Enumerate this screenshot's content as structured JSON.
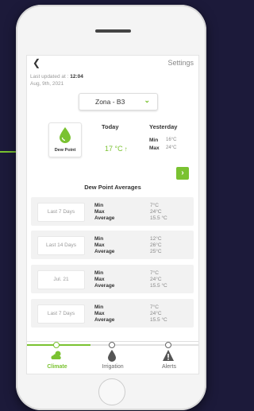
{
  "colors": {
    "accent": "#7ac231",
    "background": "#1c1a3a"
  },
  "header": {
    "back_icon": "back-arrow-icon",
    "settings_label": "Settings"
  },
  "updated": {
    "prefix": "Last updated at : ",
    "time": "12:04",
    "date": "Aug, 9th, 2021"
  },
  "zone": {
    "label": "Zona - B3",
    "icon": "chevron-down-icon"
  },
  "dew_point": {
    "label": "Dew Point",
    "icon": "droplet-icon"
  },
  "today": {
    "heading": "Today",
    "value": "17 °C",
    "trend_icon": "arrow-up-icon"
  },
  "yesterday": {
    "heading": "Yesterday",
    "min_label": "Min",
    "min_value": "16°C",
    "max_label": "Max",
    "max_value": "24°C"
  },
  "next_icon": "chevron-right-icon",
  "averages": {
    "title": "Dew Point Averages",
    "labels": {
      "min": "Min",
      "max": "Max",
      "avg": "Average"
    },
    "rows": [
      {
        "period": "Last 7 Days",
        "min": "7°C",
        "max": "24°C",
        "avg": "15.5 °C"
      },
      {
        "period": "Last 14 Days",
        "min": "12°C",
        "max": "26°C",
        "avg": "25°C"
      },
      {
        "period": "Jul. 21",
        "min": "7°C",
        "max": "24°C",
        "avg": "15.5 °C"
      },
      {
        "period": "Last 7 Days",
        "min": "7°C",
        "max": "24°C",
        "avg": "15.5 °C"
      }
    ]
  },
  "tabs": [
    {
      "label": "Climate",
      "icon": "cloud-sun-icon",
      "active": true
    },
    {
      "label": "Irrigation",
      "icon": "droplet-icon",
      "active": false
    },
    {
      "label": "Alerts",
      "icon": "warning-icon",
      "active": false
    }
  ]
}
